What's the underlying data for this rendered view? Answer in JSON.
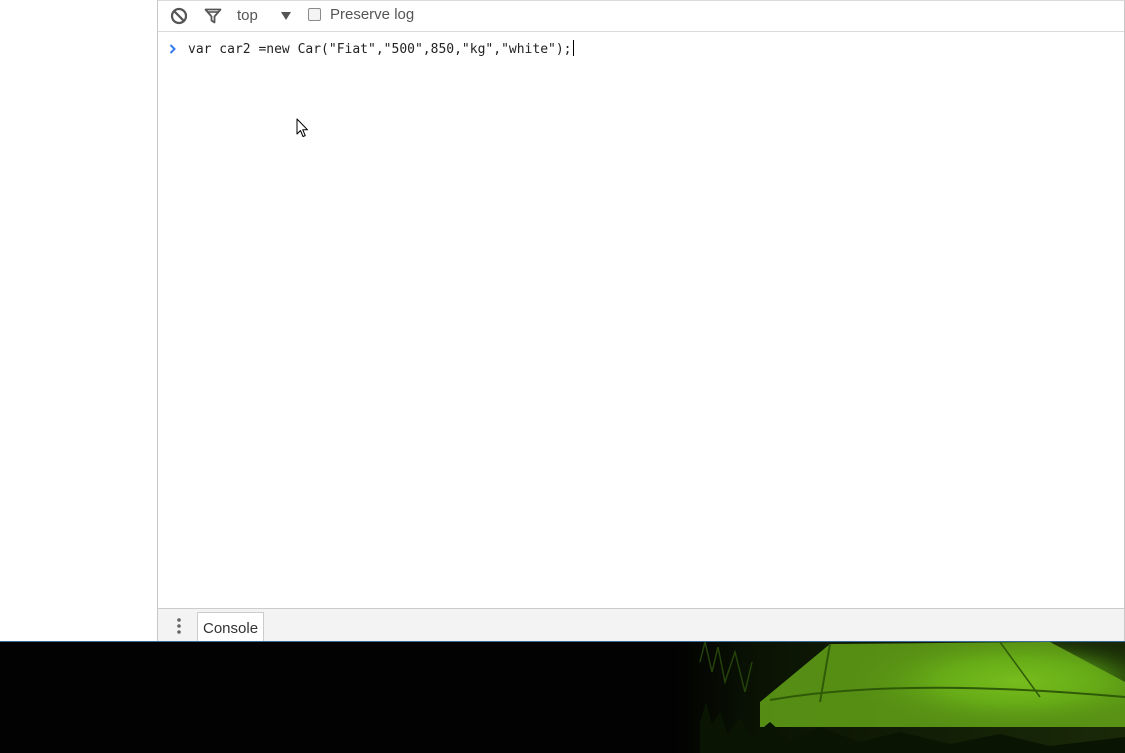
{
  "toolbar": {
    "clear_icon": "clear-console-icon",
    "filter_icon": "filter-icon",
    "context_label": "top",
    "context_dropdown_icon": "dropdown-arrow-icon",
    "preserve_log_label": "Preserve log",
    "preserve_log_checked": false
  },
  "console": {
    "prompt_icon": "chevron-right-icon",
    "input_text": "var car2 =new Car(\"Fiat\",\"500\",850,\"kg\",\"white\");"
  },
  "drawer": {
    "menu_icon": "more-vertical-icon",
    "tab_label": "Console"
  },
  "colors": {
    "prompt_accent": "#367cf1",
    "toolbar_text": "#555555",
    "drawer_bg": "#f3f3f3",
    "photo_green": "#6fb51a"
  }
}
